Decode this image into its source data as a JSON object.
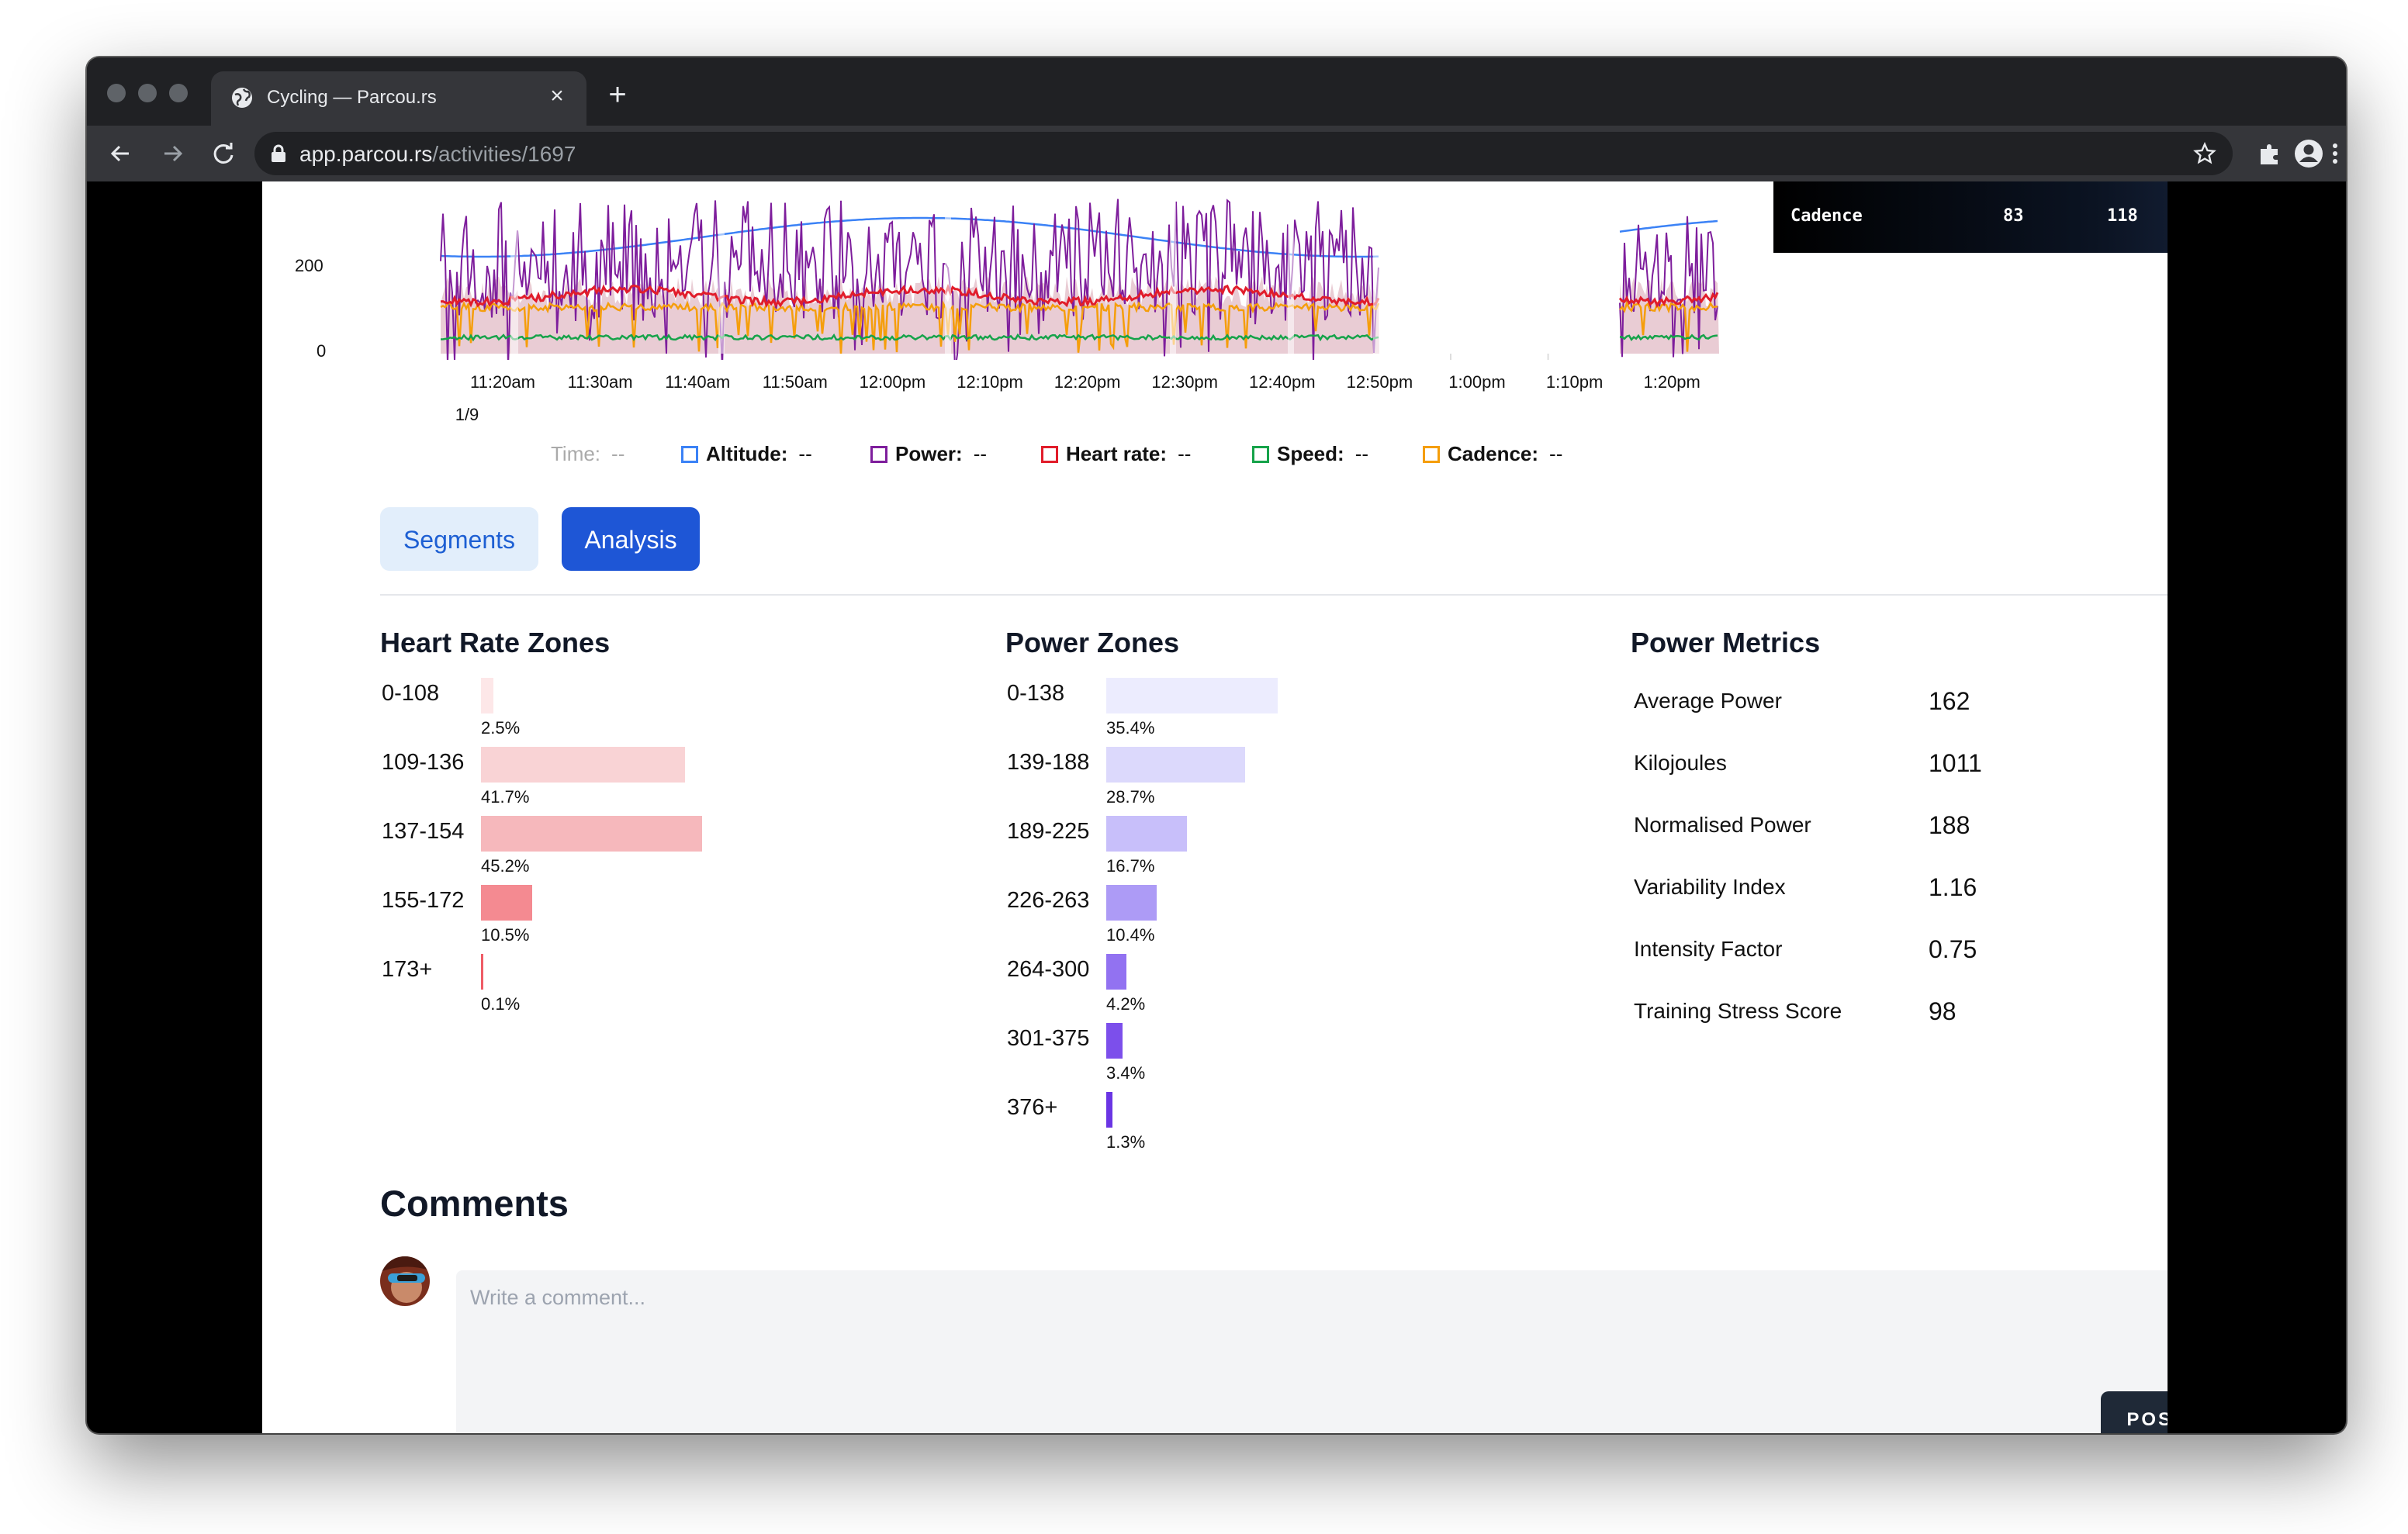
{
  "browser": {
    "tab_title": "Cycling — Parcou.rs",
    "url_host": "app.parcou.rs",
    "url_path": "/activities/1697"
  },
  "icons": [
    "globe-icon",
    "close-icon",
    "plus-icon",
    "back-icon",
    "forward-icon",
    "reload-icon",
    "lock-icon",
    "star-icon",
    "puzzle-icon",
    "profile-icon",
    "kebab-menu-icon"
  ],
  "chart_data": {
    "type": "line",
    "y_ticks": [
      "200",
      "0"
    ],
    "x_ticks": [
      "11:20am",
      "11:30am",
      "11:40am",
      "11:50am",
      "12:00pm",
      "12:10pm",
      "12:20pm",
      "12:30pm",
      "12:40pm",
      "12:50pm",
      "1:00pm",
      "1:10pm",
      "1:20pm"
    ],
    "x_date": "1/9",
    "series": [
      {
        "name": "Altitude",
        "color": "#3b82f6"
      },
      {
        "name": "Power",
        "color": "#7e1e9c"
      },
      {
        "name": "Heart rate",
        "color": "#e11d2b"
      },
      {
        "name": "Speed",
        "color": "#16a34a"
      },
      {
        "name": "Cadence",
        "color": "#f59e0b"
      }
    ],
    "gaps": [
      [
        "12:52pm",
        "1:15pm"
      ]
    ]
  },
  "tooltip": {
    "label": "Cadence",
    "avg": "83",
    "max": "118"
  },
  "legend": {
    "time_label": "Time:",
    "empty_value": "--",
    "items": [
      {
        "label": "Altitude:",
        "color": "#3b82f6"
      },
      {
        "label": "Power:",
        "color": "#7e1e9c"
      },
      {
        "label": "Heart rate:",
        "color": "#e11d2b"
      },
      {
        "label": "Speed:",
        "color": "#16a34a"
      },
      {
        "label": "Cadence:",
        "color": "#f59e0b"
      }
    ]
  },
  "tabs": {
    "segments": "Segments",
    "analysis": "Analysis"
  },
  "heart_rate_zones": {
    "title": "Heart Rate Zones",
    "zones": [
      {
        "range": "0-108",
        "pct": "2.5%",
        "value": 2.5,
        "color": "#fde7e8"
      },
      {
        "range": "109-136",
        "pct": "41.7%",
        "value": 41.7,
        "color": "#f9d3d5"
      },
      {
        "range": "137-154",
        "pct": "45.2%",
        "value": 45.2,
        "color": "#f6b8bc"
      },
      {
        "range": "155-172",
        "pct": "10.5%",
        "value": 10.5,
        "color": "#f48a91"
      },
      {
        "range": "173+",
        "pct": "0.1%",
        "value": 0.1,
        "color": "#ef5c66"
      }
    ]
  },
  "power_zones": {
    "title": "Power Zones",
    "zones": [
      {
        "range": "0-138",
        "pct": "35.4%",
        "value": 35.4,
        "color": "#ececfe"
      },
      {
        "range": "139-188",
        "pct": "28.7%",
        "value": 28.7,
        "color": "#dcd9fc"
      },
      {
        "range": "189-225",
        "pct": "16.7%",
        "value": 16.7,
        "color": "#c8bffa"
      },
      {
        "range": "226-263",
        "pct": "10.4%",
        "value": 10.4,
        "color": "#ad9bf6"
      },
      {
        "range": "264-300",
        "pct": "4.2%",
        "value": 4.2,
        "color": "#9272f1"
      },
      {
        "range": "301-375",
        "pct": "3.4%",
        "value": 3.4,
        "color": "#7c4feb"
      },
      {
        "range": "376+",
        "pct": "1.3%",
        "value": 1.3,
        "color": "#6a35e4"
      }
    ]
  },
  "power_metrics": {
    "title": "Power Metrics",
    "items": [
      {
        "label": "Average Power",
        "value": "162"
      },
      {
        "label": "Kilojoules",
        "value": "1011"
      },
      {
        "label": "Normalised Power",
        "value": "188"
      },
      {
        "label": "Variability Index",
        "value": "1.16"
      },
      {
        "label": "Intensity Factor",
        "value": "0.75"
      },
      {
        "label": "Training Stress Score",
        "value": "98"
      }
    ]
  },
  "comments": {
    "title": "Comments",
    "placeholder": "Write a comment...",
    "post_label": "POST"
  }
}
